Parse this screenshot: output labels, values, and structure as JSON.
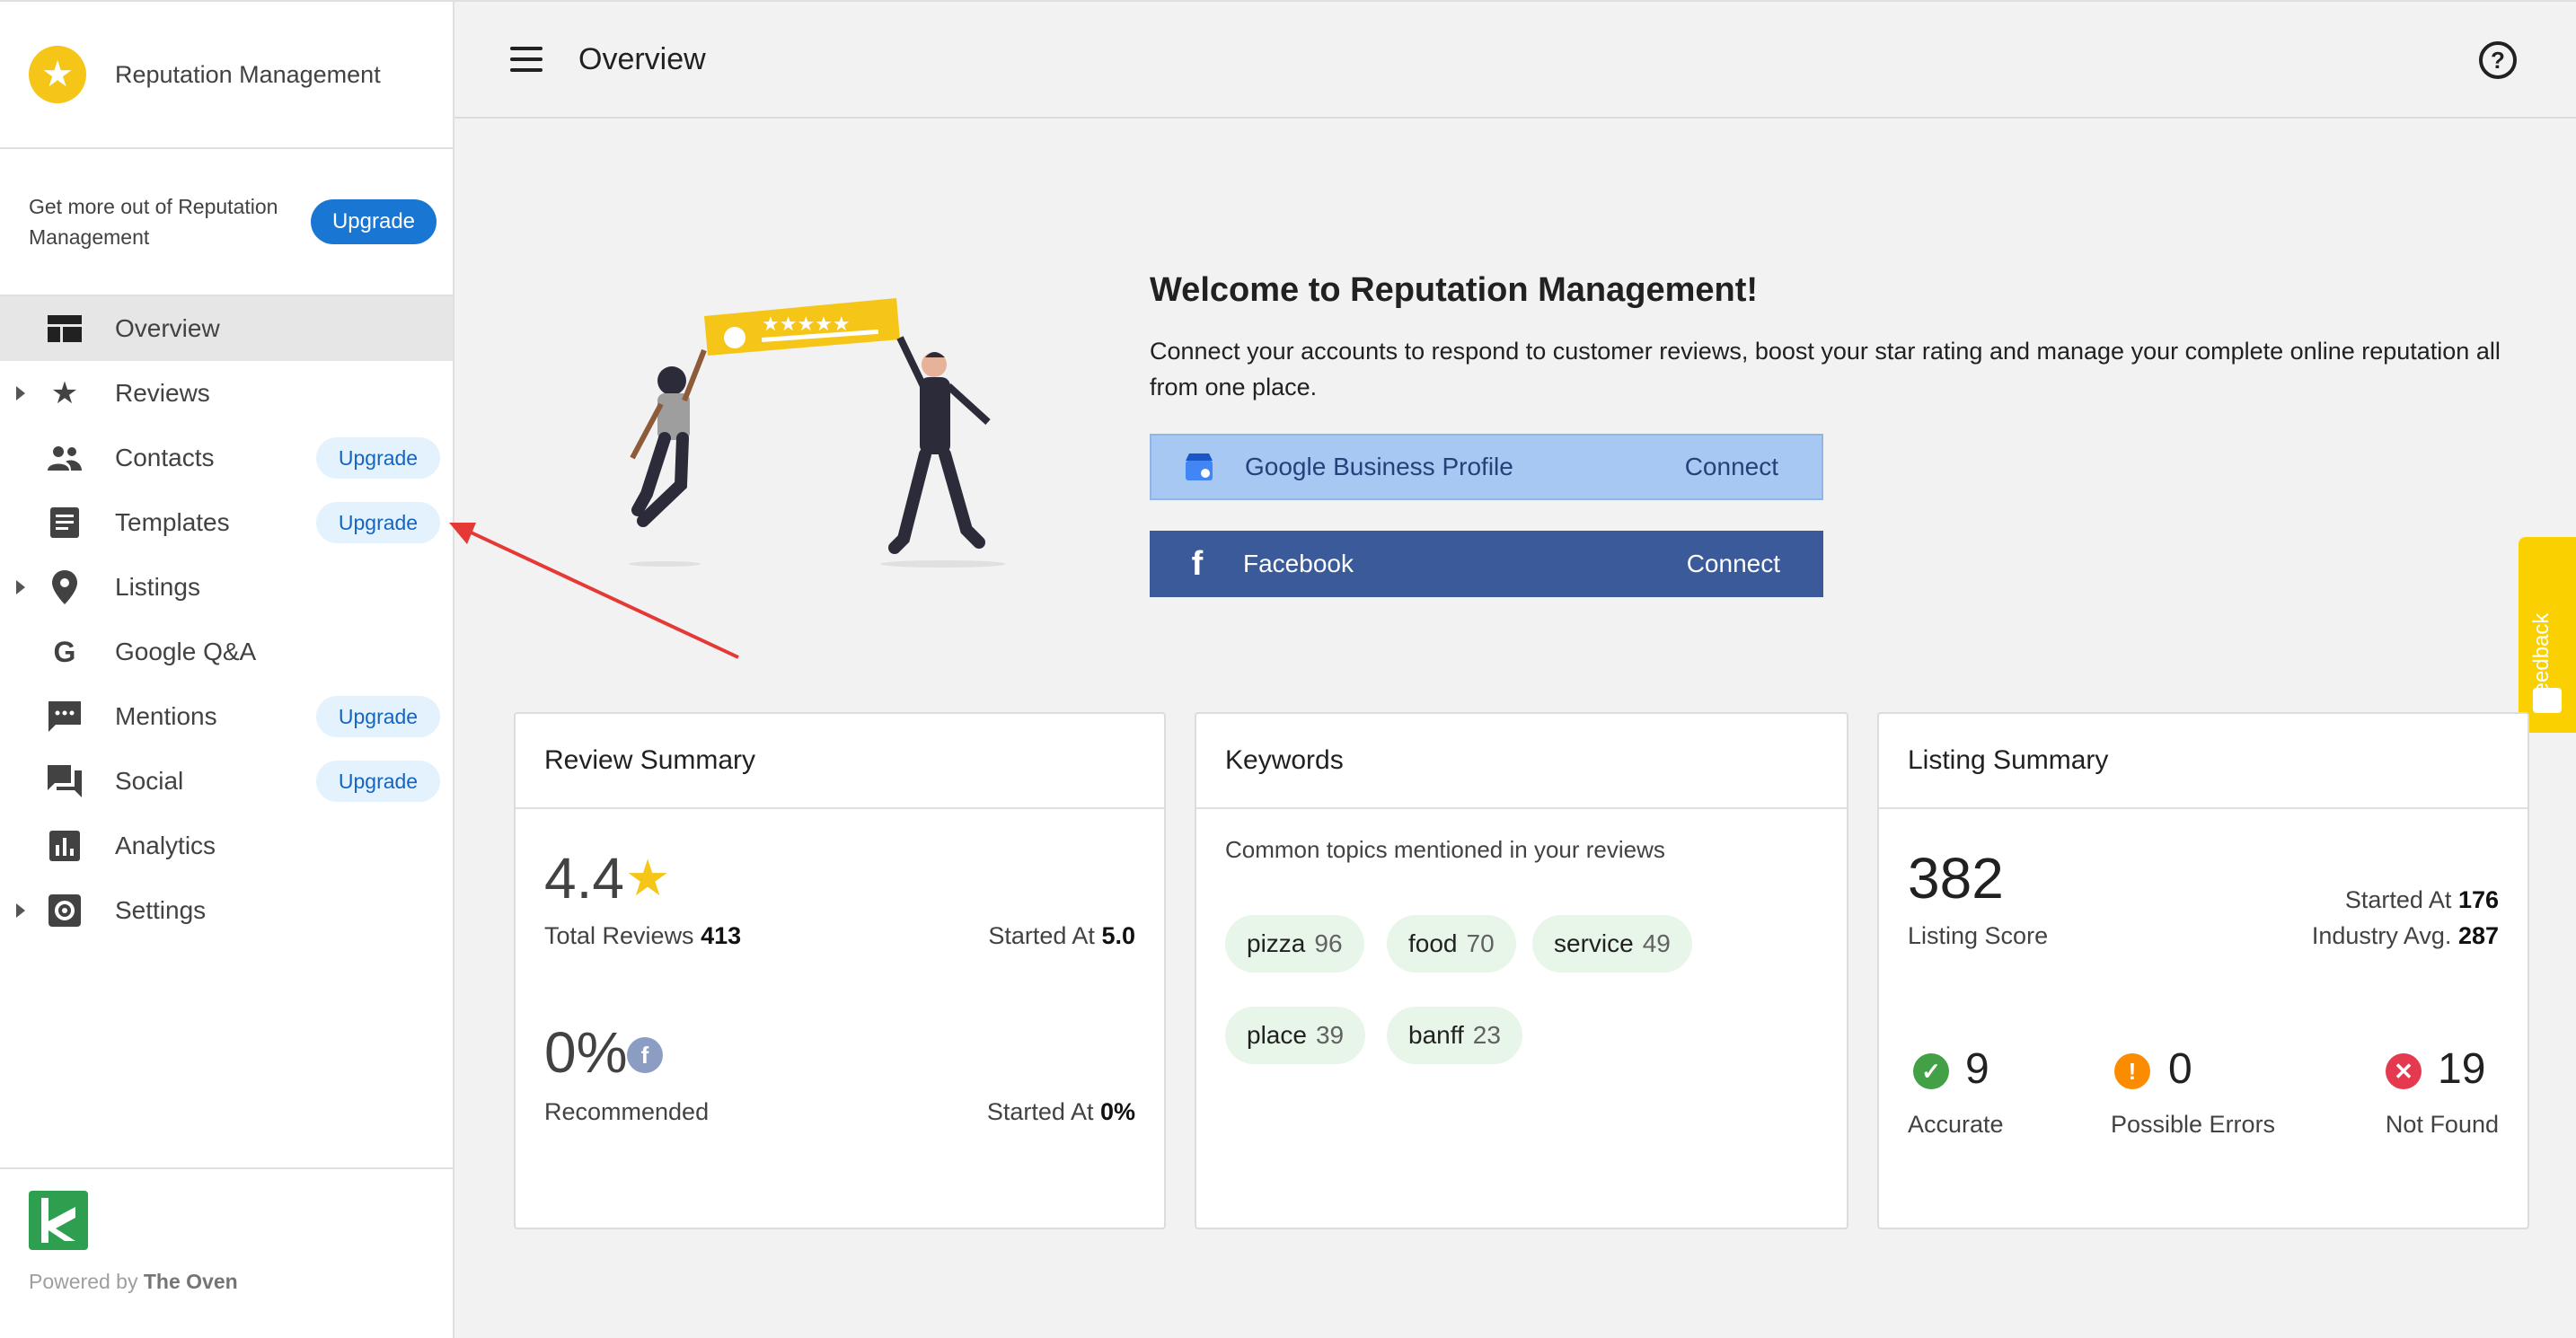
{
  "sidebar": {
    "brand": "Reputation Management",
    "promo_text": "Get more out of Reputation Management",
    "promo_button": "Upgrade",
    "items": [
      {
        "label": "Overview",
        "icon": "dashboard-icon"
      },
      {
        "label": "Reviews",
        "icon": "star-icon"
      },
      {
        "label": "Contacts",
        "icon": "people-icon",
        "badge": "Upgrade"
      },
      {
        "label": "Templates",
        "icon": "document-icon",
        "badge": "Upgrade"
      },
      {
        "label": "Listings",
        "icon": "location-pin-icon"
      },
      {
        "label": "Google Q&A",
        "icon": "google-icon"
      },
      {
        "label": "Mentions",
        "icon": "chat-bubble-icon",
        "badge": "Upgrade"
      },
      {
        "label": "Social",
        "icon": "forum-icon",
        "badge": "Upgrade"
      },
      {
        "label": "Analytics",
        "icon": "bar-chart-icon"
      },
      {
        "label": "Settings",
        "icon": "gear-icon"
      }
    ],
    "footer_prefix": "Powered by",
    "footer_brand": "The Oven"
  },
  "header": {
    "title": "Overview"
  },
  "welcome": {
    "title": "Welcome to Reputation Management!",
    "text": "Connect your accounts to respond to customer reviews, boost your star rating and manage your complete online reputation all from one place.",
    "google_label": "Google Business Profile",
    "google_action": "Connect",
    "facebook_label": "Facebook",
    "facebook_action": "Connect"
  },
  "feedback": "Feedback",
  "review_summary": {
    "title": "Review Summary",
    "rating": "4.4",
    "total_label": "Total Reviews",
    "total_value": "413",
    "started_label": "Started At",
    "started_value": "5.0",
    "recommended_pct": "0%",
    "recommended_label": "Recommended",
    "rec_started_label": "Started At",
    "rec_started_value": "0%"
  },
  "keywords": {
    "title": "Keywords",
    "subtitle": "Common topics mentioned in your reviews",
    "chips": [
      {
        "word": "pizza",
        "count": "96"
      },
      {
        "word": "food",
        "count": "70"
      },
      {
        "word": "service",
        "count": "49"
      },
      {
        "word": "place",
        "count": "39"
      },
      {
        "word": "banff",
        "count": "23"
      }
    ]
  },
  "listing_summary": {
    "title": "Listing Summary",
    "score": "382",
    "score_label": "Listing Score",
    "started_label": "Started At",
    "started_value": "176",
    "industry_label": "Industry Avg.",
    "industry_value": "287",
    "accurate_value": "9",
    "accurate_label": "Accurate",
    "errors_value": "0",
    "errors_label": "Possible Errors",
    "notfound_value": "19",
    "notfound_label": "Not Found"
  },
  "colors": {
    "accent": "#1976d2",
    "brand_yellow": "#f5c518",
    "facebook": "#3b5a9a",
    "google_bg": "#a6c8f2",
    "chip_bg": "#e8f5e9",
    "success": "#43a047",
    "warning": "#fb8c00",
    "error": "#e53950"
  }
}
